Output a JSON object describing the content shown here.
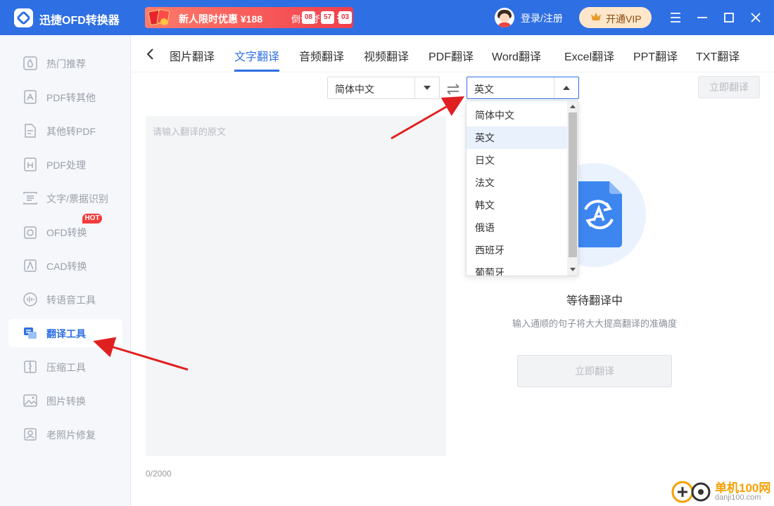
{
  "app": {
    "title": "迅捷OFD转换器",
    "logo_icon": "app-logo-icon"
  },
  "promo": {
    "text": "新人限时优惠 ¥188",
    "countdown_label": "倒计时",
    "hours": "08",
    "minutes": "57",
    "seconds": "03"
  },
  "header": {
    "login_label": "登录/注册",
    "vip_label": "开通VIP",
    "accent_color": "#2f6fe4"
  },
  "sidebar": {
    "items": [
      {
        "label": "热门推荐",
        "icon": "hot-recommend-icon"
      },
      {
        "label": "PDF转其他",
        "icon": "pdf-convert-icon"
      },
      {
        "label": "其他转PDF",
        "icon": "to-pdf-icon"
      },
      {
        "label": "PDF处理",
        "icon": "pdf-process-icon"
      },
      {
        "label": "文字/票据识别",
        "icon": "ocr-icon"
      },
      {
        "label": "OFD转换",
        "icon": "ofd-icon",
        "badge": "HOT"
      },
      {
        "label": "CAD转换",
        "icon": "cad-icon"
      },
      {
        "label": "转语音工具",
        "icon": "voice-icon"
      },
      {
        "label": "翻译工具",
        "icon": "translate-icon",
        "active": true
      },
      {
        "label": "压缩工具",
        "icon": "compress-icon"
      },
      {
        "label": "图片转换",
        "icon": "image-convert-icon"
      },
      {
        "label": "老照片修复",
        "icon": "photo-restore-icon"
      }
    ]
  },
  "tabs": {
    "items": [
      "图片翻译",
      "文字翻译",
      "音频翻译",
      "视频翻译",
      "PDF翻译",
      "Word翻译",
      "Excel翻译",
      "PPT翻译",
      "TXT翻译"
    ],
    "active": "文字翻译"
  },
  "translator": {
    "source_lang": "简体中文",
    "target_lang": "英文",
    "translate_top_label": "立即翻译",
    "source_placeholder": "请输入翻译的原文",
    "char_count": "0/2000",
    "waiting_title": "等待翻译中",
    "waiting_hint": "输入通顺的句子将大大提高翻译的准确度",
    "translate_main_label": "立即翻译"
  },
  "dropdown": {
    "options": [
      "简体中文",
      "英文",
      "日文",
      "法文",
      "韩文",
      "俄语",
      "西班牙",
      "葡萄牙"
    ],
    "selected": "英文"
  },
  "watermark": {
    "text": "单机100网",
    "url": "danji100.com"
  }
}
